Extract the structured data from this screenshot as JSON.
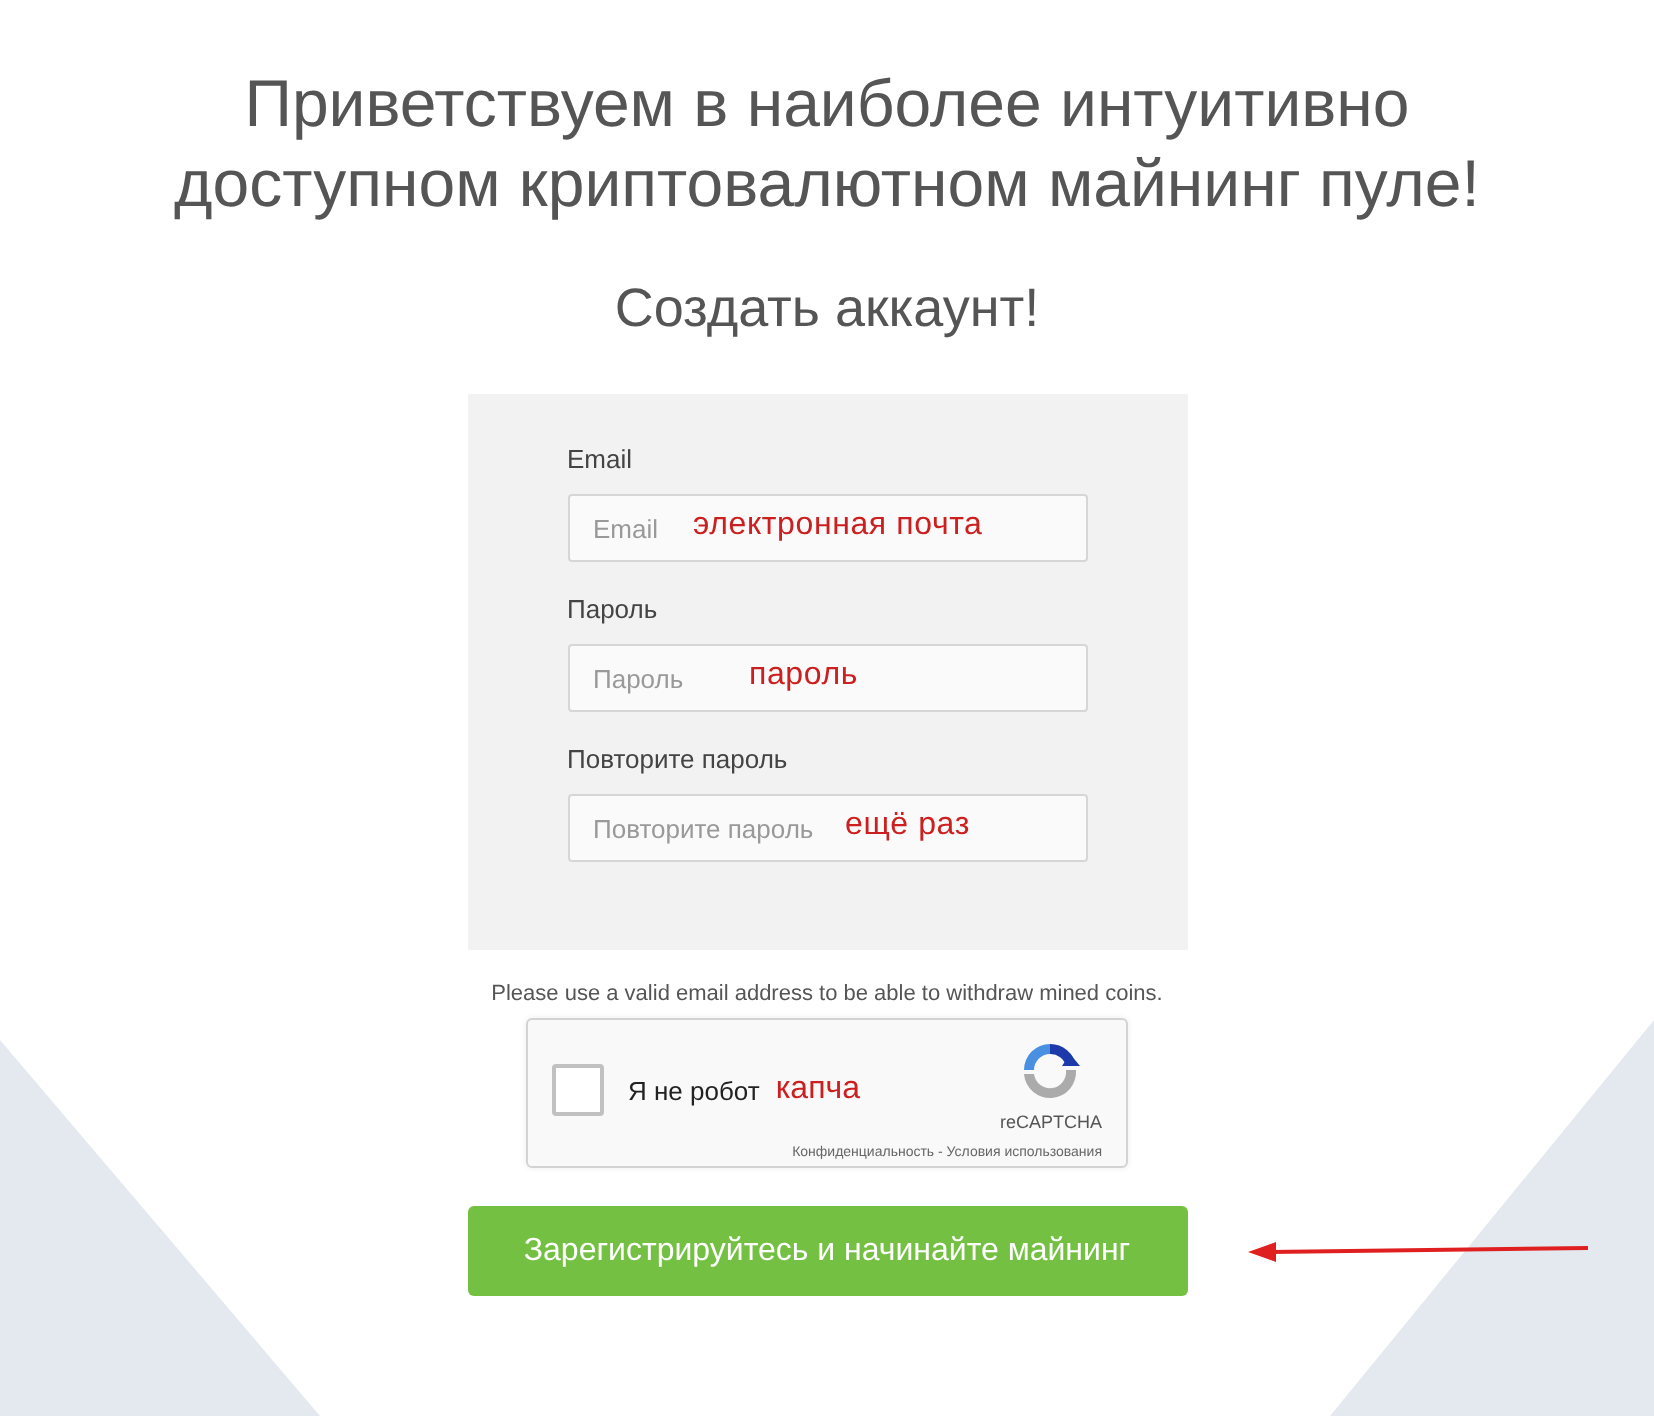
{
  "heading": "Приветствуем в наиболее интуитивно доступном криптовалютном майнинг пуле!",
  "subtitle": "Создать аккаунт!",
  "form": {
    "fields": [
      {
        "label": "Email",
        "placeholder": "Email",
        "annotation": "электронная почта"
      },
      {
        "label": "Пароль",
        "placeholder": "Пароль",
        "annotation": "пароль"
      },
      {
        "label": "Повторите пароль",
        "placeholder": "Повторите пароль",
        "annotation": "ещё раз"
      }
    ]
  },
  "note": "Please use a valid email address to be able to withdraw mined coins.",
  "captcha": {
    "label": "Я не робот",
    "checked": false,
    "annotation": "капча",
    "brand": "reCAPTCHA",
    "footer": "Конфиденциальность - Условия использования"
  },
  "submit": {
    "label": "Зарегистрируйтесь и начинайте майнинг"
  }
}
